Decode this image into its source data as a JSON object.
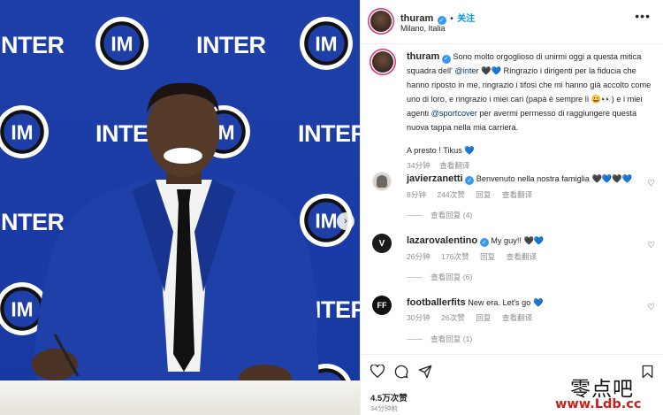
{
  "photo": {
    "wall_text": "INTER"
  },
  "post": {
    "username": "thuram",
    "follow_label": "关注",
    "location": "Milano, Italia",
    "caption": {
      "username": "thuram",
      "t1": "Sono molto orgoglioso di unirmi oggi a questa mitica squadra dell' ",
      "mention1": "@inter",
      "t2": " 🖤💙 Ringrazio i dirigenti per la fiducia che hanno riposto in me, ringrazio i tifosi che mi hanno già accolto come uno di loro, e ringrazio i miei cari (papà è sempre lì 😀👀) e i miei agenti ",
      "mention2": "@sportcover",
      "t3": " per avermi permesso di raggiungere questa nuova tappa nella mia carriera.",
      "t4": "A presto ! Tikus 💙",
      "time": "34分钟",
      "translate": "查看翻译"
    },
    "comments": [
      {
        "username": "javierzanetti",
        "text": "Benvenuto nella nostra famiglia 🖤💙🖤💙",
        "time": "8分钟",
        "likes": "244次赞",
        "reply": "回复",
        "translate": "查看翻译",
        "view_replies": "查看回复 (4)"
      },
      {
        "username": "lazarovalentino",
        "text": "My guy!! 🖤💙",
        "time": "26分钟",
        "likes": "176次赞",
        "reply": "回复",
        "translate": "查看翻译",
        "view_replies": "查看回复 (6)"
      },
      {
        "username": "footballerfits",
        "text": "New era. Let's go 💙",
        "time": "30分钟",
        "likes": "26次赞",
        "reply": "回复",
        "translate": "查看翻译",
        "view_replies": "查看回复 (1)"
      }
    ],
    "likes_count": "4.5万次赞",
    "posted_ago": "34分钟前",
    "lazaro_initial": "V",
    "ff_initials": "FF"
  },
  "watermark": {
    "chinese": "零点吧",
    "url": "www.Ldb.cc"
  },
  "colors": {
    "wall_blue": "#1f3fa8",
    "suit_blue": "#1e40a8",
    "link_blue": "#0095f6",
    "verified_blue": "#3897f0",
    "watermark_red": "#c8201d"
  }
}
